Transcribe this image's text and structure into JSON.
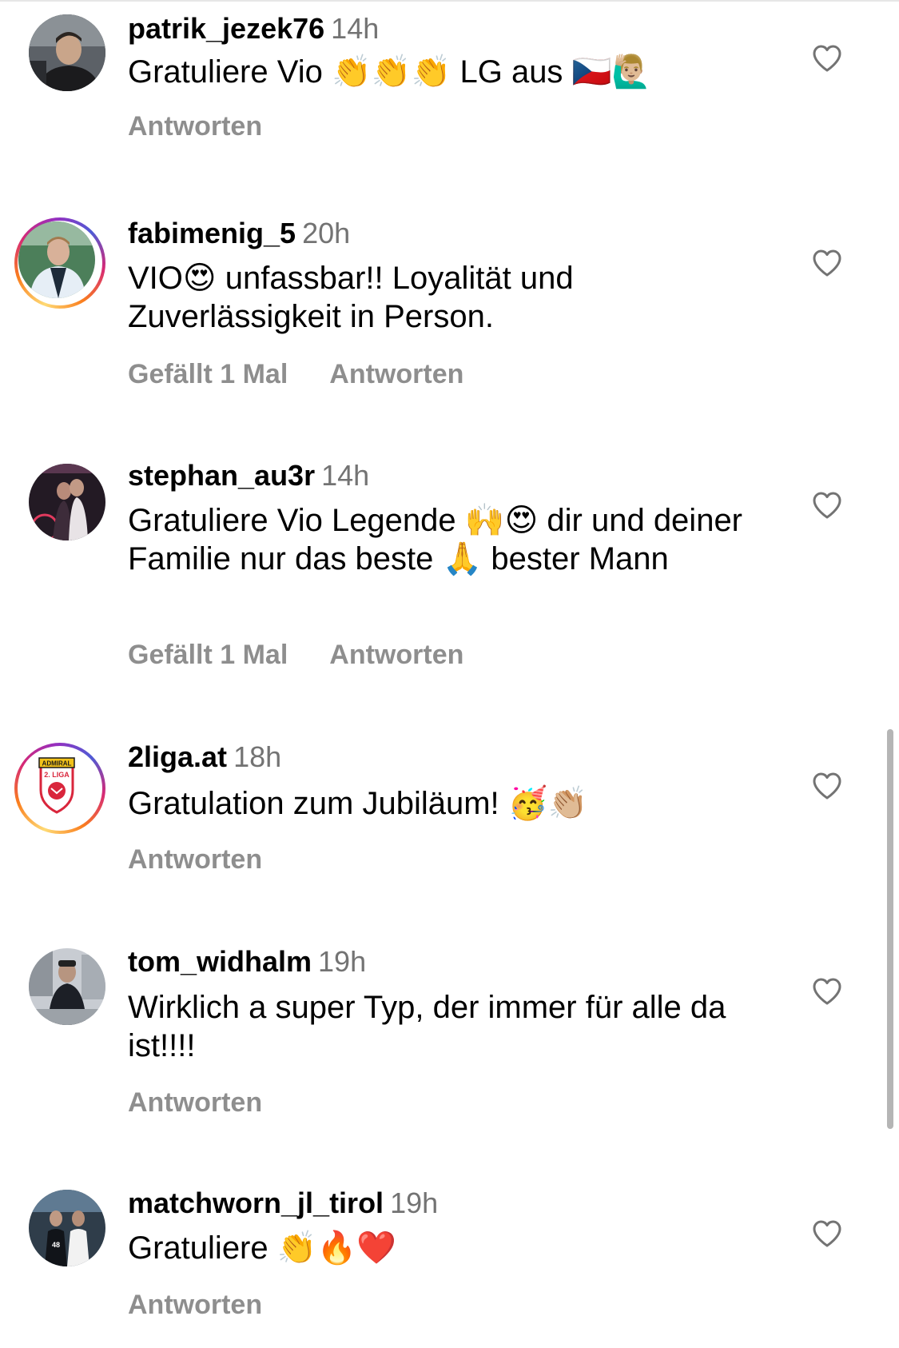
{
  "comments": [
    {
      "username": "patrik_jezek76",
      "time": "14h",
      "text": "Gratuliere Vio 👏👏👏 LG aus 🇨🇿🙋🏼‍♂️",
      "likes": "",
      "reply": "Antworten",
      "avatar_icon": "profile-photo-car-driver",
      "story_ring": false
    },
    {
      "username": "fabimenig_5",
      "time": "20h",
      "text": "VIO😍 unfassbar!! Loyalität und Zuverlässigkeit in Person.",
      "likes": "Gefällt 1 Mal",
      "reply": "Antworten",
      "avatar_icon": "profile-photo-man-jacket",
      "story_ring": true
    },
    {
      "username": "stephan_au3r",
      "time": "14h",
      "text": "Gratuliere Vio Legende 🙌😍 dir und deiner Familie nur das beste 🙏 bester Mann",
      "likes": "Gefällt 1 Mal",
      "reply": "Antworten",
      "avatar_icon": "profile-photo-night-couple",
      "story_ring": false
    },
    {
      "username": "2liga.at",
      "time": "18h",
      "text": "Gratulation zum Jubiläum! 🥳👏🏼",
      "likes": "",
      "reply": "Antworten",
      "avatar_icon": "admiral-2-liga-logo",
      "story_ring": true,
      "logo": {
        "top": "ADMIRAL",
        "bottom": "2. LIGA"
      }
    },
    {
      "username": "tom_widhalm",
      "time": "19h",
      "text": "Wirklich a super Typ, der immer für alle da ist!!!!",
      "likes": "",
      "reply": "Antworten",
      "avatar_icon": "profile-photo-man-street",
      "story_ring": false
    },
    {
      "username": "matchworn_jl_tirol",
      "time": "19h",
      "text": "Gratuliere 👏🔥❤️",
      "likes": "",
      "reply": "Antworten",
      "avatar_icon": "profile-photo-jersey-display",
      "story_ring": false
    }
  ],
  "colors": {
    "text": "#000000",
    "secondary": "#737373",
    "action": "#8e8e8e",
    "story_ring_start": "#feda75",
    "story_ring_end": "#d62976"
  },
  "icons": {
    "like": "heart-outline-icon"
  }
}
